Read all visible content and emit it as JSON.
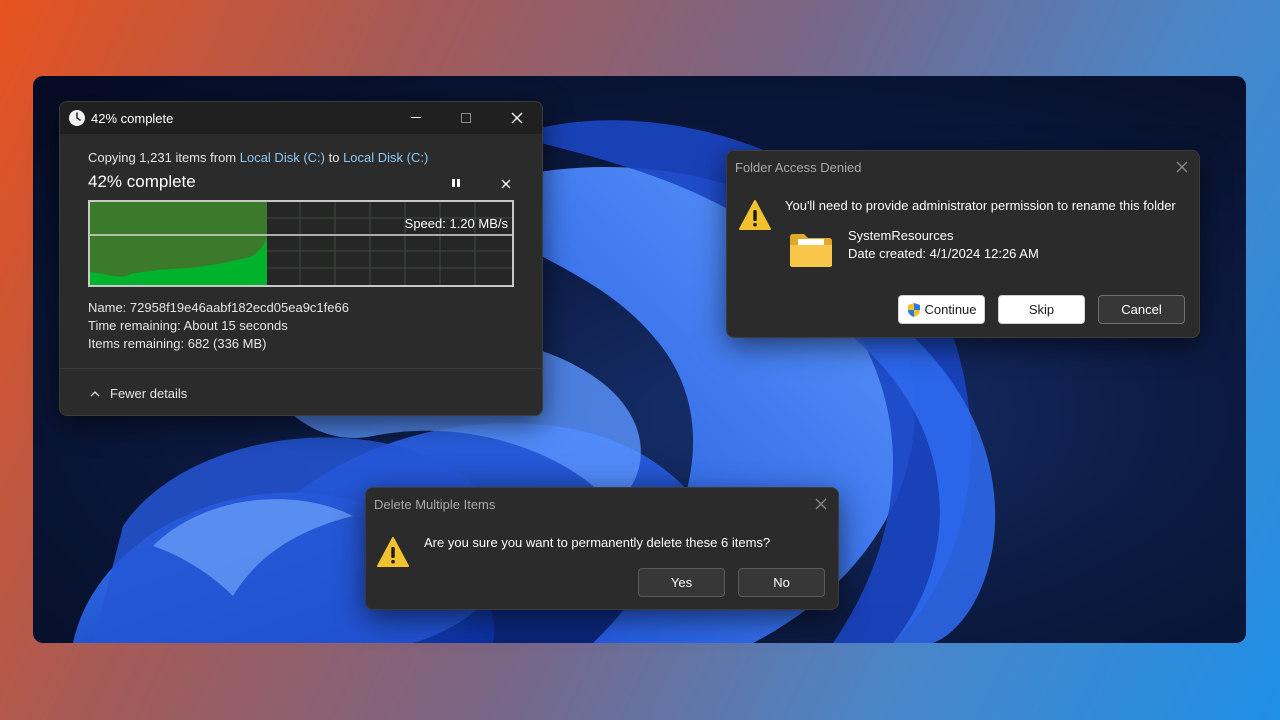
{
  "copy_dialog": {
    "title": "42% complete",
    "copying_prefix": "Copying 1,231 items from ",
    "source": "Local Disk (C:)",
    "to_word": " to ",
    "destination": "Local Disk (C:)",
    "status": "42% complete",
    "speed": "Speed: 1.20 MB/s",
    "progress_fraction": 0.42,
    "name_label": "Name:",
    "name_value": "72958f19e46aabf182ecd05ea9c1fe66",
    "time_label": "Time remaining:",
    "time_value": "About 15 seconds",
    "items_label": "Items remaining:",
    "items_value": "682 (336 MB)",
    "fewer_details": "Fewer details"
  },
  "access_dialog": {
    "title": "Folder Access Denied",
    "message": "You'll need to provide administrator permission to rename this folder",
    "folder_name": "SystemResources",
    "date_created": "Date created: 4/1/2024 12:26 AM",
    "continue_label": "Continue",
    "skip_label": "Skip",
    "cancel_label": "Cancel"
  },
  "delete_dialog": {
    "title": "Delete Multiple Items",
    "message": "Are you sure you want to permanently delete these 6 items?",
    "yes_label": "Yes",
    "no_label": "No"
  },
  "colors": {
    "graph_fill": "#00b32c",
    "graph_fill_dark": "#3a7a2a",
    "warning": "#f2c12e",
    "link": "#8cc8f5"
  },
  "icons": [
    "clock-icon",
    "minimize-icon",
    "maximize-icon",
    "close-icon",
    "pause-icon",
    "stop-icon",
    "chevron-up-icon",
    "warning-icon",
    "folder-icon",
    "uac-shield-icon"
  ]
}
